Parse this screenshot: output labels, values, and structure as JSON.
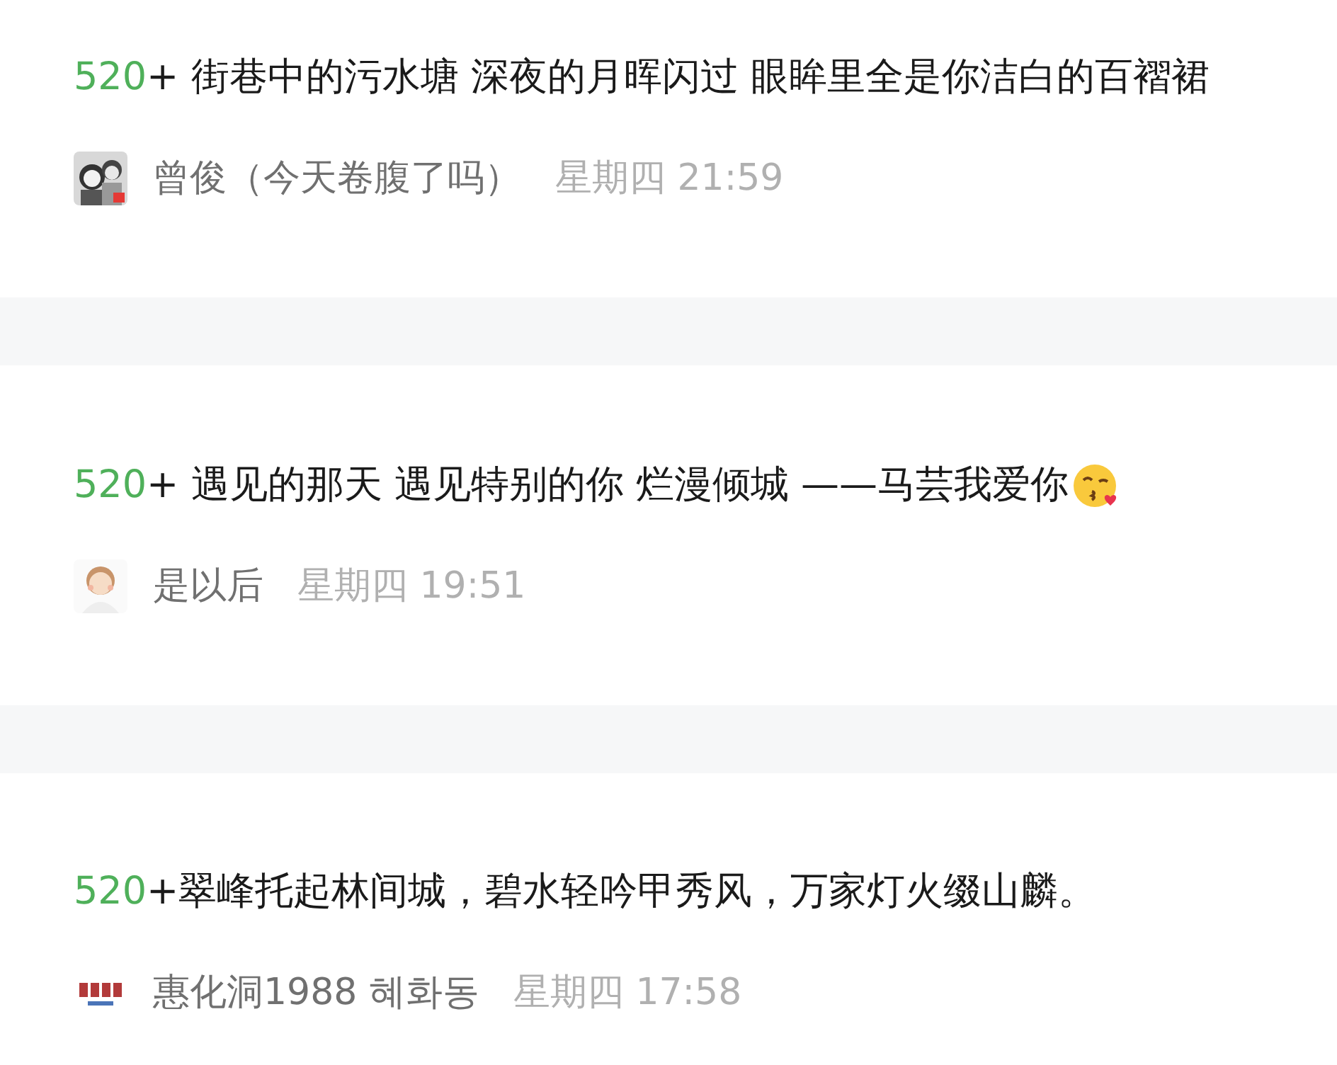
{
  "posts": [
    {
      "count": "520",
      "text": "+ 街巷中的污水塘 深夜的月晖闪过 眼眸里全是你洁白的百褶裙",
      "emoji": false,
      "author": "曾俊（今天卷腹了吗）",
      "time": "星期四 21:59"
    },
    {
      "count": "520",
      "text": "+ 遇见的那天 遇见特别的你 烂漫倾城 ——马芸我爱你",
      "emoji": true,
      "author": "是以后",
      "time": "星期四 19:51"
    },
    {
      "count": "520",
      "text": "+翠峰托起林间城，碧水轻吟甲秀风，万家灯火缀山麟。",
      "emoji": false,
      "author": "惠化洞1988 혜화동",
      "time": "星期四 17:58"
    }
  ]
}
